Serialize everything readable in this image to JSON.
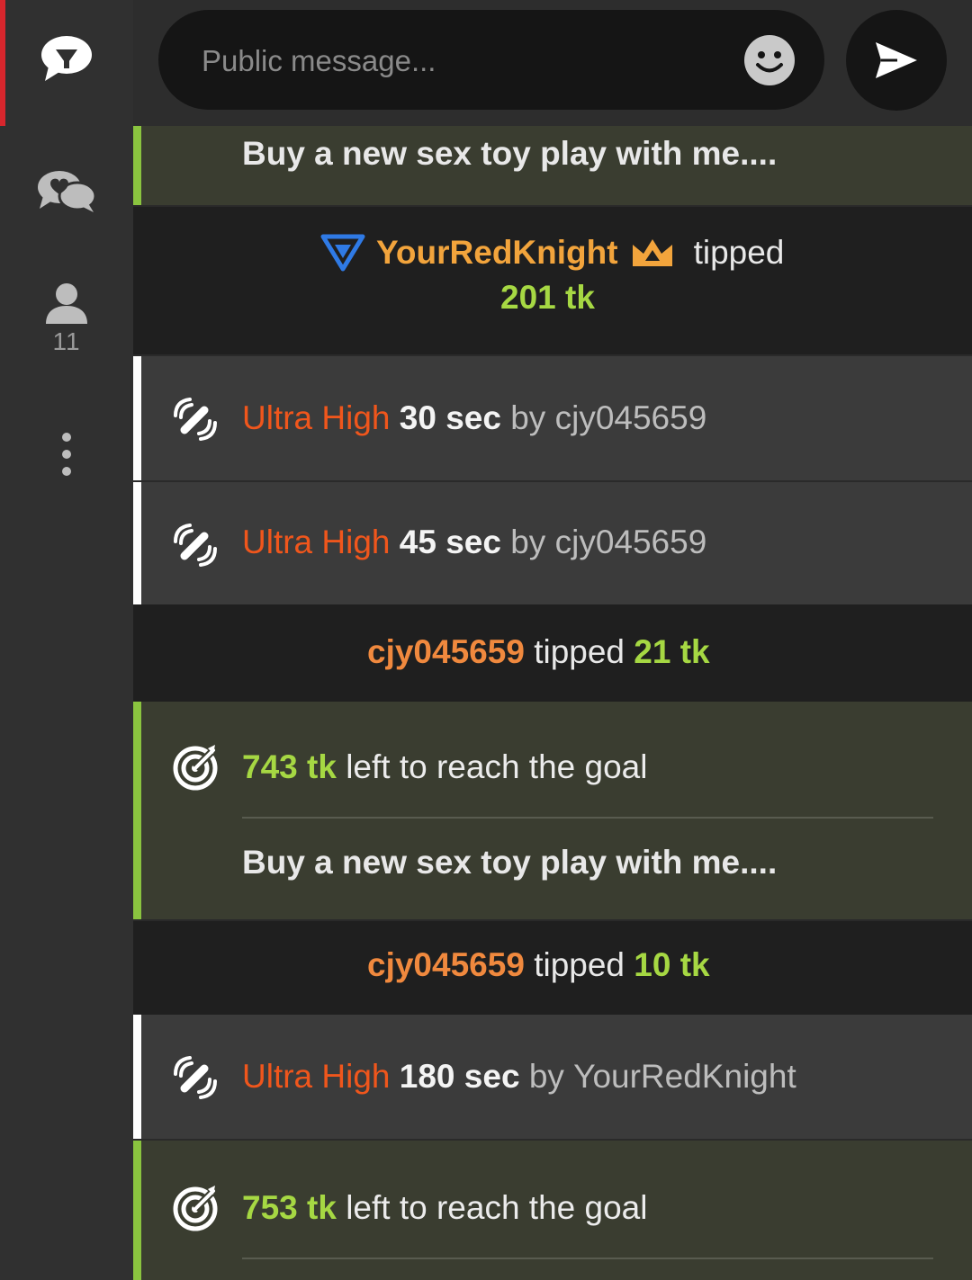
{
  "sidebar": {
    "items": [
      {
        "icon": "chat-bubble-icon",
        "active": true
      },
      {
        "icon": "private-chats-icon"
      },
      {
        "icon": "user-icon",
        "count": "11"
      },
      {
        "icon": "more-vertical-icon"
      }
    ],
    "active_color": "#d7262d"
  },
  "composer": {
    "placeholder": "Public message...",
    "emoji_icon": "smiley-icon",
    "send_icon": "send-arrow-icon"
  },
  "feed": {
    "goal_top": {
      "goal_text": "Buy a new sex toy play with me...."
    },
    "tip_1": {
      "badge_icon": "blue-triangle-badge-icon",
      "username": "YourRedKnight",
      "crown_icon": "crown-icon",
      "verb": "tipped",
      "amount": "201 tk"
    },
    "vibe_1": {
      "icon": "vibration-icon",
      "level": "Ultra High",
      "duration": "30 sec",
      "by": "by",
      "user": "cjy045659"
    },
    "vibe_2": {
      "icon": "vibration-icon",
      "level": "Ultra High",
      "duration": "45 sec",
      "by": "by",
      "user": "cjy045659"
    },
    "tip_2": {
      "username": "cjy045659",
      "verb": "tipped",
      "amount": "21 tk"
    },
    "goal_1": {
      "icon": "target-icon",
      "amount": "743 tk",
      "text": "left to reach the goal",
      "goal_text": "Buy a new sex toy play with me...."
    },
    "tip_3": {
      "username": "cjy045659",
      "verb": "tipped",
      "amount": "10 tk"
    },
    "vibe_3": {
      "icon": "vibration-icon",
      "level": "Ultra High",
      "duration": "180 sec",
      "by": "by",
      "user": "YourRedKnight"
    },
    "goal_2": {
      "icon": "target-icon",
      "amount": "753 tk",
      "text": "left to reach the goal"
    }
  },
  "colors": {
    "goal_accent": "#8ac43f",
    "token_green": "#a6d843",
    "username_orange": "#f0893e",
    "level_red": "#f0561c",
    "vip_gold": "#f2a43c"
  }
}
